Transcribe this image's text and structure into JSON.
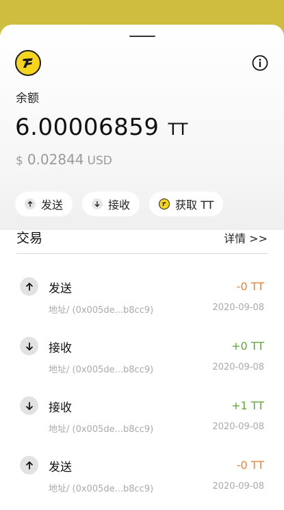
{
  "colors": {
    "brand_yellow": "#f7d51f",
    "top_bar": "#cfbd40",
    "outgoing": "#e8833a",
    "incoming": "#63a83a"
  },
  "wallet": {
    "coin_icon": "tt-coin-logo",
    "info_icon": "info-icon",
    "balance_label": "余额",
    "balance_amount": "6.00006859",
    "balance_unit": "TT",
    "fiat_symbol": "$",
    "fiat_amount": "0.02844",
    "fiat_unit": "USD"
  },
  "actions": [
    {
      "label": "发送",
      "icon": "arrow-up-icon"
    },
    {
      "label": "接收",
      "icon": "arrow-down-icon"
    },
    {
      "label": "获取 TT",
      "icon": "tt-coin-icon"
    }
  ],
  "transactions": {
    "title": "交易",
    "detail_link": "详情 >>",
    "items": [
      {
        "type": "发送",
        "direction": "out",
        "amount": "-0 TT",
        "address": "地址/ (0x005de...b8cc9)",
        "date": "2020-09-08"
      },
      {
        "type": "接收",
        "direction": "in",
        "amount": "+0 TT",
        "address": "地址/ (0x005de...b8cc9)",
        "date": "2020-09-08"
      },
      {
        "type": "接收",
        "direction": "in",
        "amount": "+1 TT",
        "address": "地址/ (0x005de...b8cc9)",
        "date": "2020-09-08"
      },
      {
        "type": "发送",
        "direction": "out",
        "amount": "-0 TT",
        "address": "地址/ (0x005de...b8cc9)",
        "date": "2020-09-08"
      }
    ]
  }
}
